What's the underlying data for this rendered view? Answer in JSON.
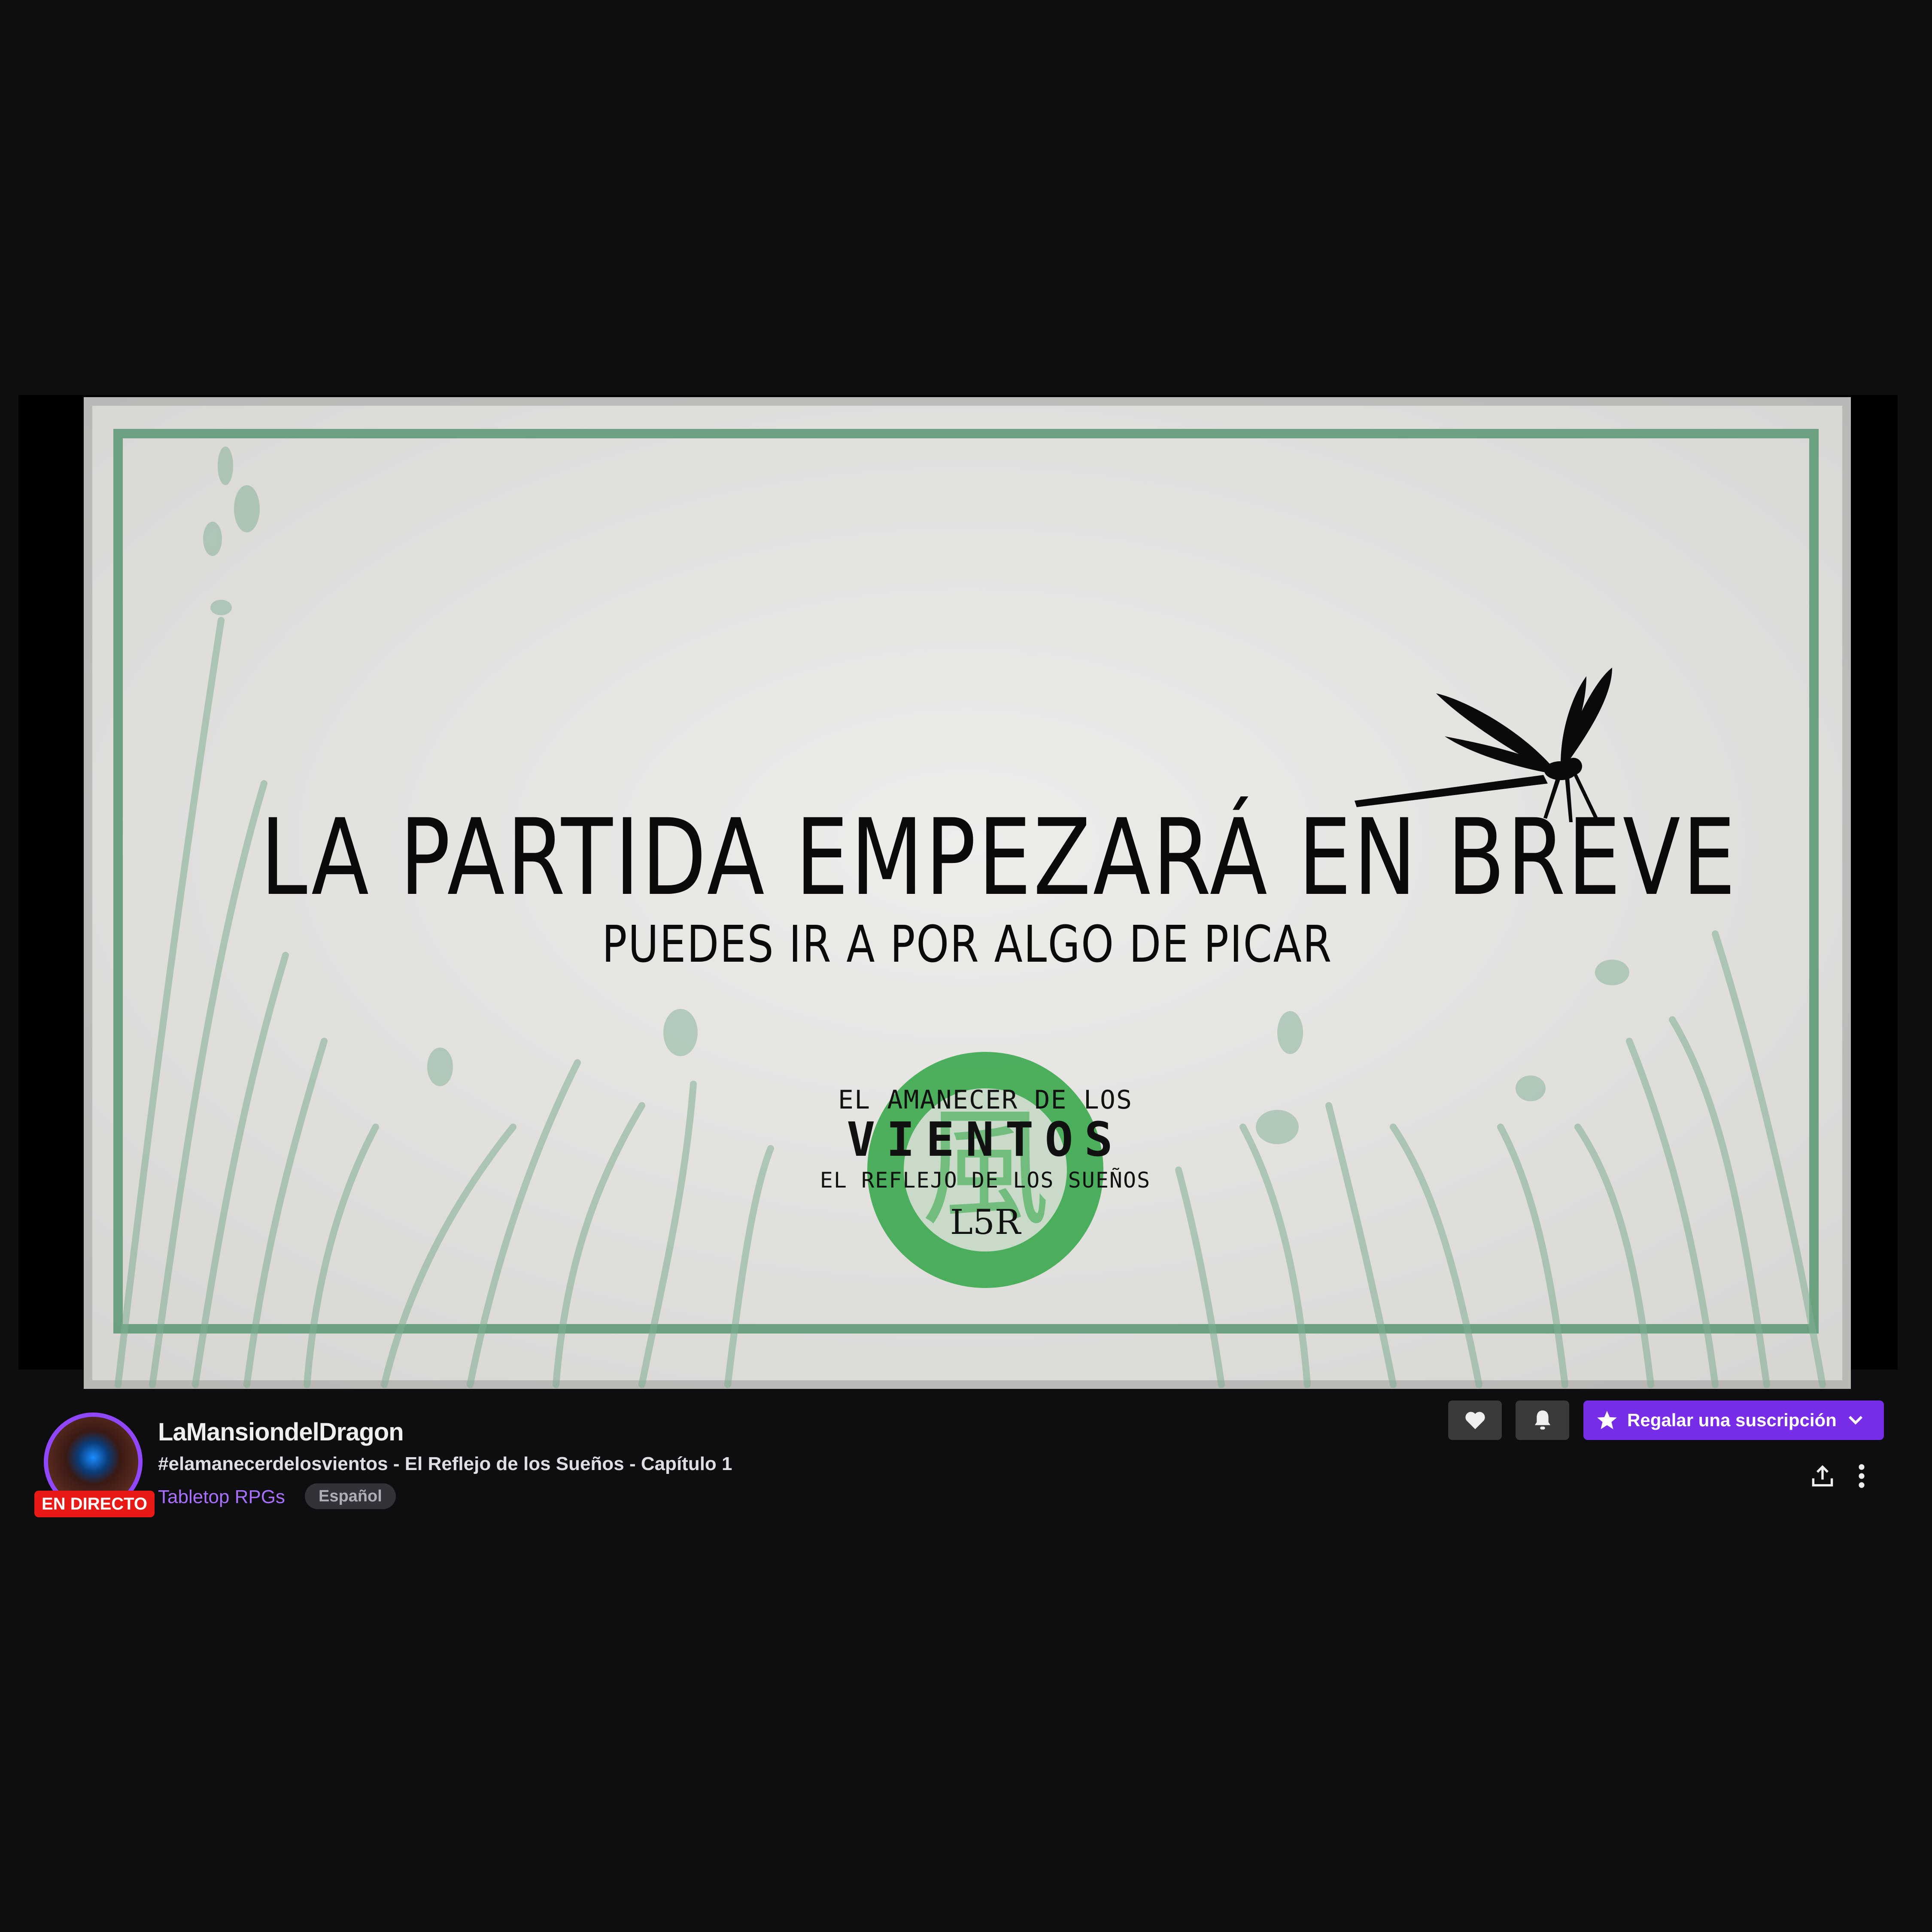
{
  "video": {
    "headline": "LA PARTIDA EMPEZARÁ EN BREVE",
    "subline": "PUEDES IR A POR ALGO DE PICAR",
    "logo": {
      "line1": "EL AMANECER DE LOS",
      "line2": "VIENTOS",
      "line3": "EL REFLEJO DE LOS SUEÑOS",
      "mark": "L5R"
    },
    "colors": {
      "frame_green": "#5e9a77",
      "logo_green": "#3aa84e",
      "paper": "#e8e6e3"
    }
  },
  "channel": {
    "name": "LaMansiondelDragon",
    "live_label": "EN DIRECTO",
    "title": "#elamanecerdelosvientos - El Reflejo de los Sueños - Capítulo 1",
    "category": "Tabletop RPGs",
    "language_tag": "Español"
  },
  "actions": {
    "follow_icon": "heart-icon",
    "notify_icon": "bell-icon",
    "gift_label": "Regalar una suscripción",
    "share_icon": "share-icon",
    "more_icon": "more-vertical-icon"
  },
  "theme": {
    "background": "#0e0e10",
    "accent_purple": "#772ce8",
    "category_purple": "#a970ff",
    "live_red": "#e91916"
  }
}
